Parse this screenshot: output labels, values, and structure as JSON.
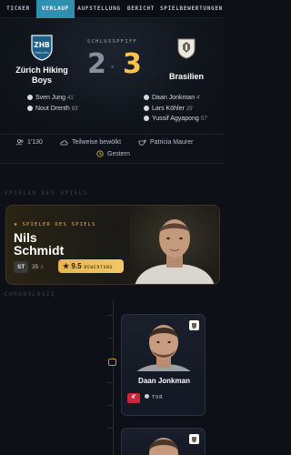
{
  "tabs": [
    {
      "label": "TICKER",
      "active": false
    },
    {
      "label": "VERLAUF",
      "active": true
    },
    {
      "label": "AUFSTELLUNG",
      "active": false
    },
    {
      "label": "BERICHT",
      "active": false
    },
    {
      "label": "SPIELBEWERTUNGEN",
      "active": false
    }
  ],
  "match": {
    "status": "SCHLUSSPFIFF",
    "home": {
      "name": "Zürich Hiking Boys",
      "crest_text": "ZHB",
      "crest_subtext": "HIKING BOYS",
      "score": "2",
      "scorers": [
        {
          "name": "Sven Jung",
          "minute": "41'"
        },
        {
          "name": "Nout Drenth",
          "minute": "83'"
        }
      ]
    },
    "away": {
      "name": "Brasilien",
      "score": "3",
      "scorers": [
        {
          "name": "Daan Jonkman",
          "minute": "4'"
        },
        {
          "name": "Lars Köhler",
          "minute": "25'"
        },
        {
          "name": "Yussif Agyapong",
          "minute": "57'"
        }
      ]
    }
  },
  "info": {
    "attendance": "1'130",
    "weather": "Teilweise bewölkt",
    "referee": "Patricia Maurer",
    "date": "Gestern"
  },
  "sections": {
    "potm": "SPIELER DES SPIELS",
    "chronology": "CHRONOLOGIE"
  },
  "potm": {
    "tag": "SPIELER DES SPIELS",
    "first_name": "Nils",
    "last_name": "Schmidt",
    "position": "ST",
    "age": "35",
    "age_unit": "J.",
    "rating": "9.5",
    "rating_label": "BEWERTUNG"
  },
  "events": [
    {
      "player": "Daan Jonkman",
      "minute": "4'",
      "type": "TOR"
    }
  ],
  "colors": {
    "accent": "#2f8fb0",
    "gold": "#e9b44a",
    "goal_badge": "#c8283a"
  }
}
